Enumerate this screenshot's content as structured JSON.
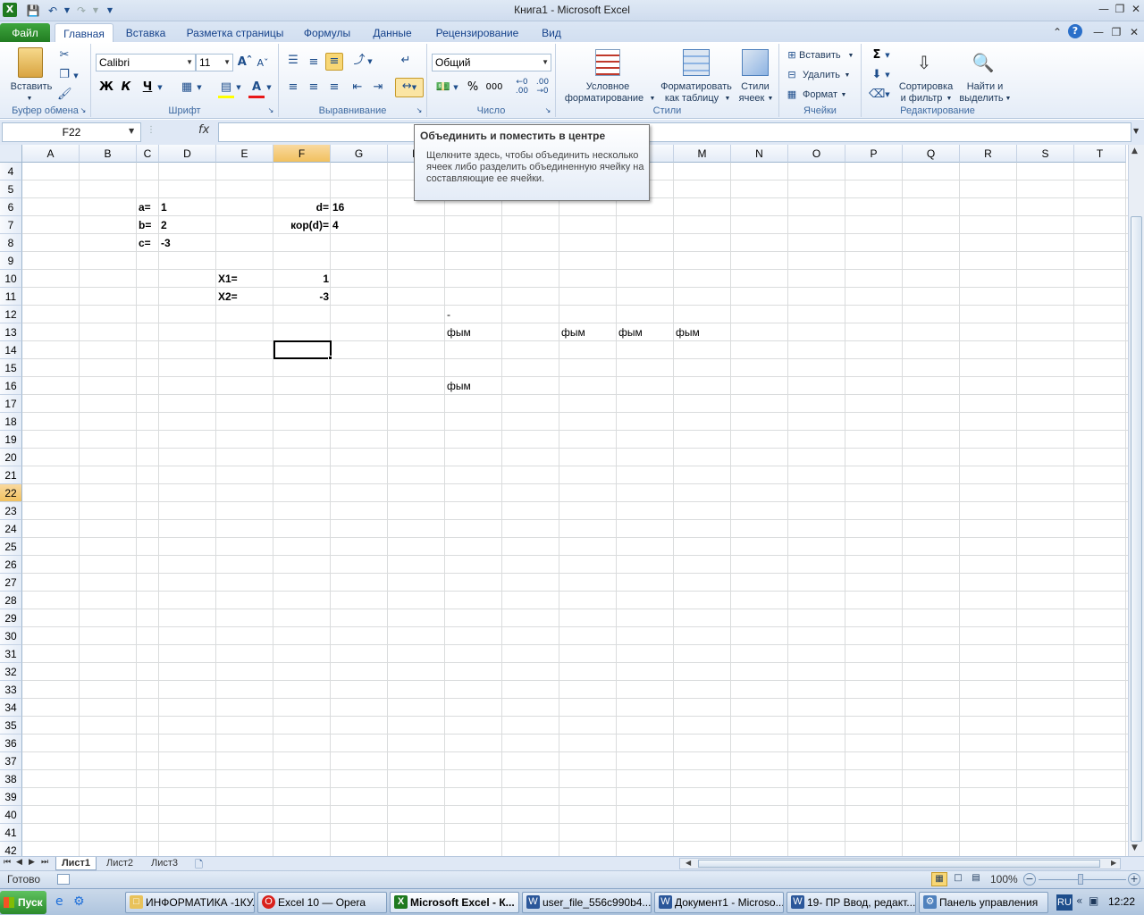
{
  "window": {
    "title": "Книга1  -  Microsoft Excel"
  },
  "tabs": [
    "Файл",
    "Главная",
    "Вставка",
    "Разметка страницы",
    "Формулы",
    "Данные",
    "Рецензирование",
    "Вид"
  ],
  "ribbon": {
    "paste_label": "Вставить",
    "font_name": "Calibri",
    "font_size": "11",
    "bold": "Ж",
    "italic": "К",
    "underline": "Ч",
    "number_format": "Общий",
    "percent": "%",
    "thousands": "000",
    "cond_format": [
      "Условное",
      "форматирование"
    ],
    "format_table": [
      "Форматировать",
      "как таблицу"
    ],
    "cell_styles": [
      "Стили",
      "ячеек"
    ],
    "insert": "Вставить",
    "delete": "Удалить",
    "format": "Формат",
    "sort": [
      "Сортировка",
      "и фильтр"
    ],
    "find": [
      "Найти и",
      "выделить"
    ],
    "groups": {
      "clipboard": "Буфер обмена",
      "font": "Шрифт",
      "alignment": "Выравнивание",
      "number": "Число",
      "styles": "Стили",
      "cells": "Ячейки",
      "editing": "Редактирование"
    }
  },
  "formula_bar": {
    "name_box": "F22",
    "fx": "fx",
    "value": ""
  },
  "tooltip": {
    "title": "Объединить и поместить в центре",
    "body": "Щелкните здесь, чтобы объединить несколько ячеек либо разделить объединенную ячейку на составляющие ее ячейки."
  },
  "columns": [
    "A",
    "B",
    "C",
    "D",
    "E",
    "F",
    "G",
    "H",
    "I",
    "J",
    "K",
    "L",
    "M",
    "N",
    "O",
    "P",
    "Q",
    "R",
    "S",
    "T"
  ],
  "rows": [
    "4",
    "5",
    "6",
    "7",
    "8",
    "9",
    "10",
    "11",
    "12",
    "13",
    "14",
    "15",
    "16",
    "17",
    "18",
    "19",
    "20",
    "21",
    "22",
    "23",
    "24",
    "25",
    "26",
    "27",
    "28",
    "29",
    "30",
    "31",
    "32",
    "33",
    "34",
    "35",
    "36",
    "37",
    "38",
    "39",
    "40",
    "41",
    "42"
  ],
  "cells": {
    "C6": "a=",
    "D6": "1",
    "F6": "d=",
    "G6": "16",
    "C7": "b=",
    "D7": "2",
    "F7": "кор(d)=",
    "G7": "4",
    "C8": "c=",
    "D8": "-3",
    "E10": "X1=",
    "F10": "1",
    "E11": "X2=",
    "F11": "-3",
    "I12": "-",
    "I13": "фым",
    "K13": "фым",
    "L13": "фым",
    "M13": "фым",
    "I16": "фым"
  },
  "sheets": [
    "Лист1",
    "Лист2",
    "Лист3"
  ],
  "status": {
    "ready": "Готово",
    "zoom": "100%"
  },
  "taskbar": {
    "start": "Пуск",
    "items": [
      "ИНФОРМАТИКА -1КУ...",
      "Excel 10 — Opera",
      "Microsoft Excel - К...",
      "user_file_556c990b4...",
      "Документ1 - Microso...",
      "19- ПР Ввод, редакт...",
      "Панель управления"
    ],
    "lang": "RU",
    "clock": "12:22"
  }
}
